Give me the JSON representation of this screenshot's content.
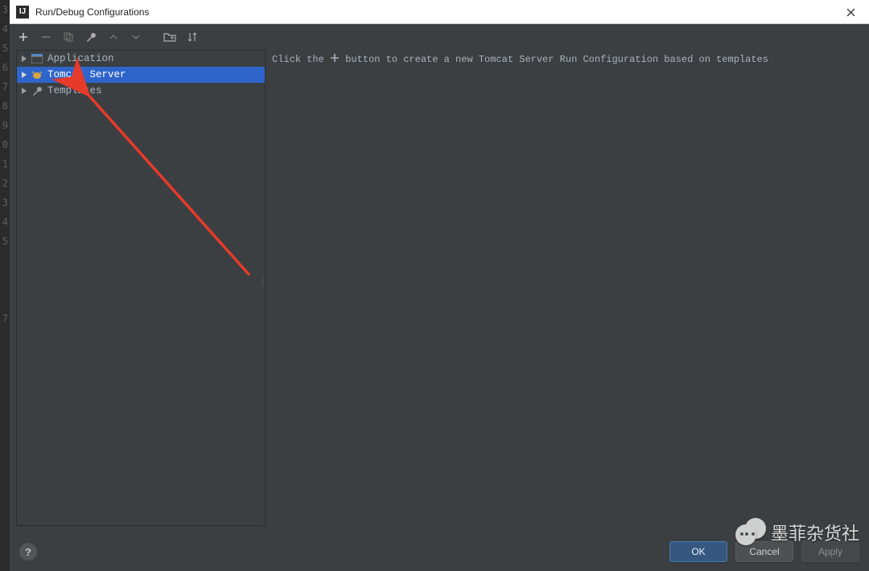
{
  "titlebar": {
    "app_glyph": "IJ",
    "title": "Run/Debug Configurations"
  },
  "tree": {
    "items": [
      {
        "label": "Application",
        "icon": "application-icon",
        "selected": false
      },
      {
        "label": "Tomcat Server",
        "icon": "tomcat-icon",
        "selected": true
      },
      {
        "label": "Templates",
        "icon": "wrench-icon",
        "selected": false
      }
    ]
  },
  "hint": {
    "prefix": "Click the",
    "suffix": "button to create a new Tomcat Server Run Configuration based on templates"
  },
  "footer": {
    "help": "?",
    "ok": "OK",
    "cancel": "Cancel",
    "apply": "Apply"
  },
  "watermark": {
    "text": "墨菲杂货社"
  },
  "gutter_numbers": [
    "3",
    "4",
    "5",
    "6",
    "7",
    "8",
    "9",
    "0",
    "1",
    "2",
    "3",
    "4",
    "5",
    "",
    "",
    "",
    "7"
  ]
}
